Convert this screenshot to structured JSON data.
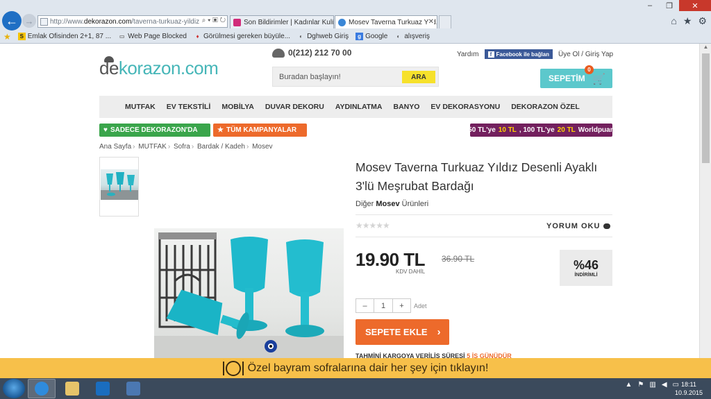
{
  "browser": {
    "address_prefix": "http://www.",
    "address_domain": "dekorazon.com",
    "address_rest": "/taverna-turkuaz-yildiz",
    "tabs": [
      {
        "label": "Son Bildirimler | Kadınlar Kulübü"
      },
      {
        "label": "Mosev Taverna Turkuaz Yıld..."
      }
    ]
  },
  "favorites": [
    {
      "label": "Emlak Ofisinden 2+1, 87 ...",
      "icon": "S",
      "color": "#f5c400"
    },
    {
      "label": "Web Page Blocked",
      "icon": "▭",
      "color": "#777777"
    },
    {
      "label": "Görülmesi gereken büyüle...",
      "icon": "♦",
      "color": "#d03030"
    },
    {
      "label": "Dghweb Giriş",
      "icon": "◐",
      "color": "#555555"
    },
    {
      "label": "Google",
      "icon": "g",
      "color": "#3a7be0"
    },
    {
      "label": "alışveriş",
      "icon": "◐",
      "color": "#555555"
    }
  ],
  "header": {
    "logo_a": "de",
    "logo_b": "korazon.com",
    "phone": "0(212) 212 70 00",
    "search_placeholder": "Buradan başlayın!",
    "search_button": "ARA",
    "help": "Yardım",
    "facebook": "Facebook ile bağlan",
    "account": "Üye Ol / Giriş Yap",
    "cart_label": "SEPETİM",
    "cart_count": "0"
  },
  "nav": [
    "MUTFAK",
    "EV TEKSTİLİ",
    "MOBİLYA",
    "DUVAR DEKORU",
    "AYDINLATMA",
    "BANYO",
    "EV DEKORASYONU",
    "DEKORAZON ÖZEL"
  ],
  "promos": {
    "green": "SADECE DEKORAZON'DA",
    "orange": "TÜM KAMPANYALAR",
    "purple_a": "50 TL'ye ",
    "purple_b": "10 TL",
    "purple_c": ", 100 TL'ye ",
    "purple_d": "20 TL",
    "purple_e": " Worldpuan"
  },
  "breadcrumb": [
    "Ana Sayfa",
    "MUTFAK",
    "Sofra",
    "Bardak / Kadeh",
    "Mosev"
  ],
  "product": {
    "title": "Mosev Taverna Turkuaz Yıldız Desenli Ayaklı 3'lü Meşrubat Bardağı",
    "brand_prefix": "Diğer ",
    "brand": "Mosev",
    "brand_suffix": " Ürünleri",
    "stars": "★★★★★",
    "review_link": "YORUM OKU",
    "price": "19.90 TL",
    "old_price": "36.90 TL",
    "kdv": "KDV DAHİL",
    "discount_pct": "%46",
    "discount_label": "İNDİRİMLİ",
    "qty_minus": "–",
    "qty_value": "1",
    "qty_plus": "+",
    "qty_unit": "Adet",
    "add_to_cart": "SEPETE EKLE",
    "shipping_label": "TAHMİNİ KARGOYA VERİLİŞ SÜRESİ ",
    "shipping_value": "5 İŞ GÜNÜDÜR"
  },
  "bottom_banner": "Özel bayram sofralarına dair her şey için tıklayın!",
  "taskbar": {
    "time": "18:11",
    "date": "10.9.2015"
  }
}
